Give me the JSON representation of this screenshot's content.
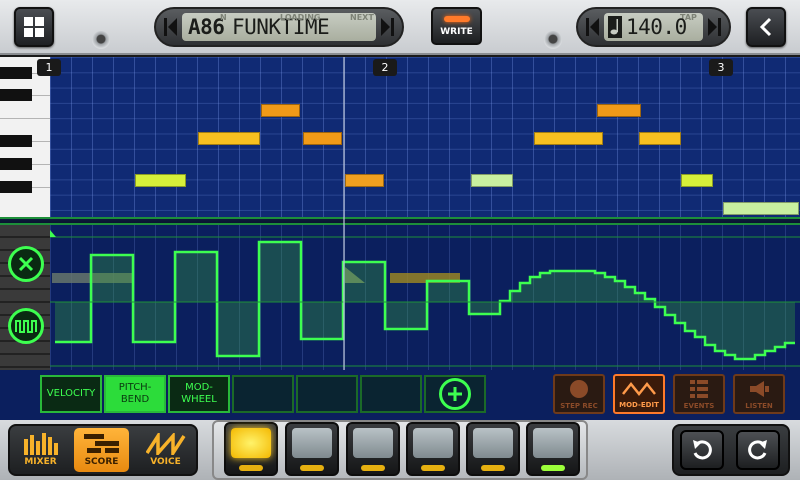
{
  "header": {
    "preset": {
      "number": "A86",
      "name": "FUNKTIME",
      "label_left": "N",
      "label_loading": "LOADING",
      "label_next": "NEXT"
    },
    "write_label": "WRITE",
    "tempo": {
      "value": "140.0",
      "label_tap": "TAP"
    }
  },
  "bars": [
    "1",
    "2",
    "3"
  ],
  "mod_tabs": [
    {
      "label": "VELOCITY",
      "active": false
    },
    {
      "label": "PITCH-BEND",
      "active": true
    },
    {
      "label": "MOD-WHEEL",
      "active": false
    }
  ],
  "edit_buttons": [
    {
      "label": "STEP REC",
      "active": false
    },
    {
      "label": "MOD-EDIT",
      "active": true
    },
    {
      "label": "EVENTS",
      "active": false
    },
    {
      "label": "LISTEN",
      "active": false
    }
  ],
  "modes": [
    {
      "label": "MIXER",
      "active": false
    },
    {
      "label": "SCORE",
      "active": true
    },
    {
      "label": "VOICE",
      "active": false
    }
  ],
  "colors": {
    "lcd_bg": "#b8bdb0",
    "accent_green": "#3dff50",
    "accent_orange": "#ff7a2a",
    "note_yellow": "#f4cf10"
  }
}
